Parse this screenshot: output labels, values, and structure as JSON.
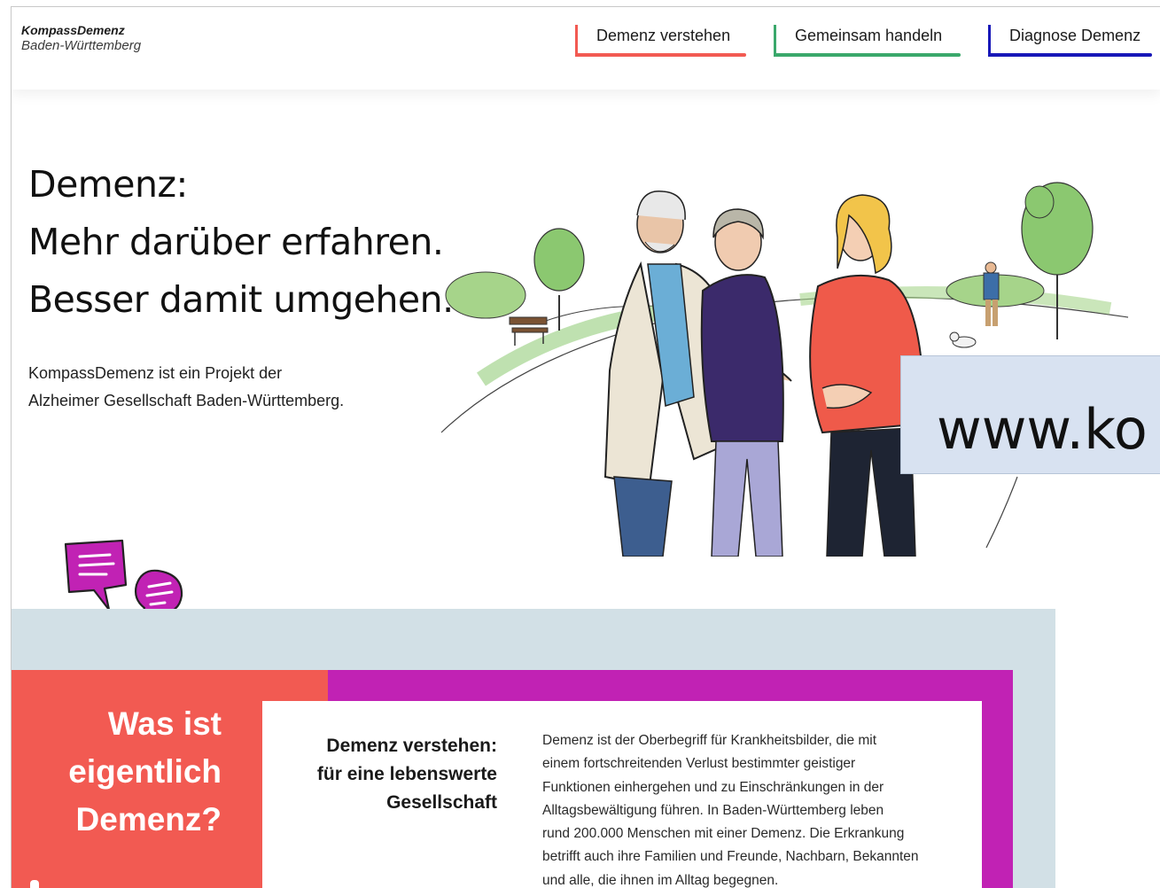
{
  "logo": {
    "title": "KompassDemenz",
    "subtitle": "Baden-Württemberg"
  },
  "nav": {
    "items": [
      {
        "label": "Demenz verstehen",
        "color": "#f25a52"
      },
      {
        "label": "Gemeinsam handeln",
        "color": "#3aa86b"
      },
      {
        "label": "Diagnose Demenz",
        "color": "#1818b8"
      }
    ]
  },
  "hero": {
    "title_lines": [
      "Demenz:",
      "Mehr darüber erfahren.",
      "Besser damit umgehen."
    ],
    "text_lines": [
      "KompassDemenz ist ein Projekt der",
      "Alzheimer Gesellschaft Baden-Württemberg."
    ]
  },
  "url_overlay": {
    "text": "www.ko"
  },
  "section": {
    "question_lines": [
      "Was ist",
      "eigentlich",
      "Demenz?"
    ],
    "card_title_lines": [
      "Demenz verstehen:",
      "für eine lebenswerte",
      "Gesellschaft"
    ],
    "card_text_lines": [
      "Demenz ist der Oberbegriff für Krankheitsbilder, die mit",
      "einem fortschreitenden Verlust bestimmter geistiger",
      "Funktionen einhergehen und zu Einschränkungen in der",
      "Alltagsbewältigung führen. In Baden-Württemberg leben",
      "rund 200.000 Menschen mit einer Demenz. Die Erkrankung",
      "betrifft auch ihre Familien und Freunde, Nachbarn, Bekannten",
      "und alle, die ihnen im Alltag begegnen."
    ]
  },
  "colors": {
    "red": "#f25a52",
    "purple": "#c122b4",
    "light_blue_bg": "#d2e0e6",
    "url_box": "#d8e2f1"
  },
  "icons": {
    "speech_bubbles": "speech-bubbles-icon"
  }
}
